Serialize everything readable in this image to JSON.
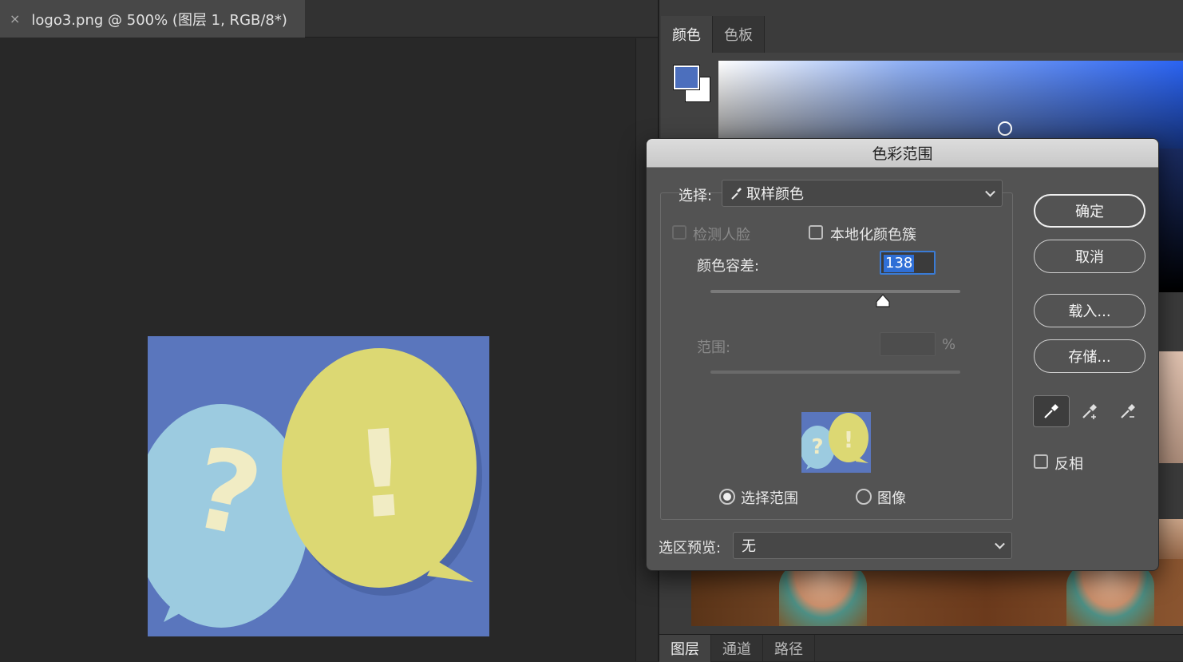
{
  "document": {
    "tab_title": "logo3.png @ 500% (图层 1, RGB/8*)",
    "close_glyph": "×"
  },
  "color_panel": {
    "tabs": [
      "颜色",
      "色板"
    ],
    "foreground_color": "#4c6fbd",
    "background_color": "#ffffff"
  },
  "layers_panel": {
    "tabs": [
      "图层",
      "通道",
      "路径"
    ]
  },
  "dialog": {
    "title": "色彩范围",
    "select_label": "选择:",
    "select_value": "取样颜色",
    "detect_faces_label": "检测人脸",
    "localized_label": "本地化颜色簇",
    "fuzziness_label": "颜色容差:",
    "fuzziness_value": "138",
    "fuzziness_level": 0.69,
    "range_label": "范围:",
    "range_unit": "%",
    "radio_selection": "选择范围",
    "radio_image": "图像",
    "preview_label": "选区预览:",
    "preview_value": "无",
    "invert_label": "反相",
    "buttons": {
      "ok": "确定",
      "cancel": "取消",
      "load": "载入...",
      "save": "存储..."
    }
  },
  "canvas": {
    "question_mark": "?",
    "exclamation_mark": "!",
    "colors": {
      "bg": "#5a76bd",
      "bubble_left": "#9ccbe0",
      "bubble_right": "#dcd873",
      "mark": "#f1ecc4"
    }
  }
}
